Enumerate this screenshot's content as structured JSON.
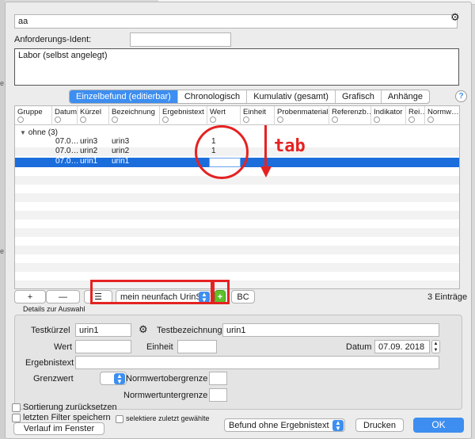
{
  "header": {
    "name_value": "aa",
    "ident_label": "Anforderungs-Ident:",
    "ident_value": "",
    "description_value": "Labor (selbst angelegt)"
  },
  "tabs": [
    {
      "label": "Einzelbefund (editierbar)",
      "active": true
    },
    {
      "label": "Chronologisch",
      "active": false
    },
    {
      "label": "Kumulativ (gesamt)",
      "active": false
    },
    {
      "label": "Grafisch",
      "active": false
    },
    {
      "label": "Anhänge",
      "active": false
    }
  ],
  "help_label": "?",
  "table": {
    "columns": [
      "Gruppe",
      "Datum",
      "Kürzel",
      "Bezeichnung",
      "Ergebnistext",
      "Wert",
      "Einheit",
      "Probenmaterial",
      "Referenzb…",
      "Indikator",
      "Rei…",
      "Normw…"
    ],
    "group_label": "ohne (3)",
    "rows": [
      {
        "datum": "07.0…",
        "kuerzel": "urin3",
        "bezeichnung": "urin3",
        "wert": "1",
        "selected": false
      },
      {
        "datum": "07.0…",
        "kuerzel": "urin2",
        "bezeichnung": "urin2",
        "wert": "1",
        "selected": false
      },
      {
        "datum": "07.0…",
        "kuerzel": "urin1",
        "bezeichnung": "urin1",
        "wert": "",
        "selected": true
      }
    ]
  },
  "toolbar": {
    "add_label": "+",
    "remove_label": "—",
    "list_label": "☰",
    "profile_value": "mein neunfach UrinS…",
    "green_add_label": "+",
    "bc_label": "BC",
    "count_label": "3 Einträge"
  },
  "details": {
    "legend": "Details zur Auswahl",
    "testkuerzel_label": "Testkürzel",
    "testkuerzel_value": "urin1",
    "testbezeichnung_label": "Testbezeichnung",
    "testbezeichnung_value": "urin1",
    "wert_label": "Wert",
    "wert_value": "",
    "einheit_label": "Einheit",
    "einheit_value": "",
    "datum_label": "Datum",
    "datum_value": "07.09. 2018",
    "ergebnistext_label": "Ergebnistext",
    "ergebnistext_value": "",
    "grenzwert_label": "Grenzwert",
    "grenzwert_value": "",
    "normober_label": "Normwertobergrenze",
    "normunter_label": "Normwertuntergrenze"
  },
  "footer": {
    "sort_reset_label": "Sortierung zurücksetzen",
    "save_filter_label": "letzten Filter speichern",
    "history_label": "Verlauf im Fenster",
    "select_last_label": "selektiere zuletzt gewählte",
    "befund_option": "Befund ohne Ergebnistext",
    "print_label": "Drucken",
    "ok_label": "OK"
  },
  "annotation": {
    "text": "tab",
    "color": "#e52222"
  },
  "colors": {
    "accent": "#3d8ef0",
    "selection": "#1a6ddb",
    "green": "#5cc12a"
  }
}
